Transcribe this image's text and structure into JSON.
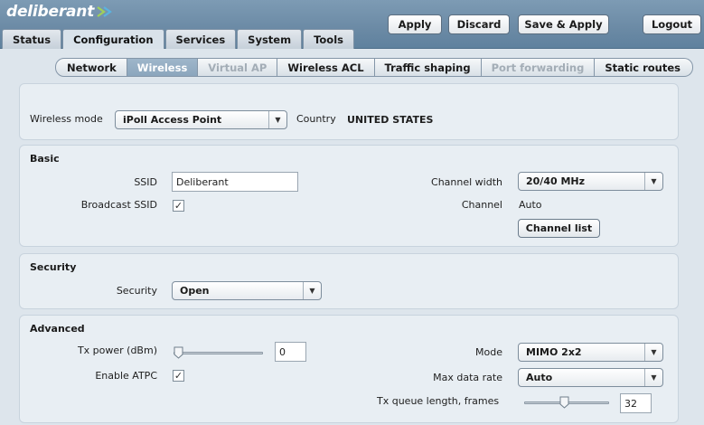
{
  "app": {
    "logo_text": "deliberant"
  },
  "toolbar": {
    "apply_label": "Apply",
    "discard_label": "Discard",
    "save_apply_label": "Save & Apply",
    "logout_label": "Logout"
  },
  "main_tabs": [
    {
      "label": "Status"
    },
    {
      "label": "Configuration",
      "active": true
    },
    {
      "label": "Services"
    },
    {
      "label": "System"
    },
    {
      "label": "Tools"
    }
  ],
  "sub_tabs": [
    {
      "label": "Network"
    },
    {
      "label": "Wireless",
      "active": true
    },
    {
      "label": "Virtual AP",
      "disabled": true
    },
    {
      "label": "Wireless ACL"
    },
    {
      "label": "Traffic shaping"
    },
    {
      "label": "Port forwarding",
      "disabled": true
    },
    {
      "label": "Static routes"
    }
  ],
  "general": {
    "wireless_mode_label": "Wireless mode",
    "wireless_mode_value": "iPoll Access Point",
    "country_label": "Country",
    "country_value": "UNITED STATES"
  },
  "basic": {
    "title": "Basic",
    "ssid_label": "SSID",
    "ssid_value": "Deliberant",
    "broadcast_ssid_label": "Broadcast SSID",
    "broadcast_ssid_checked": true,
    "channel_width_label": "Channel width",
    "channel_width_value": "20/40 MHz",
    "channel_label": "Channel",
    "channel_value": "Auto",
    "channel_list_label": "Channel list"
  },
  "security": {
    "title": "Security",
    "security_label": "Security",
    "security_value": "Open"
  },
  "advanced": {
    "title": "Advanced",
    "tx_power_label": "Tx power (dBm)",
    "tx_power_value": "0",
    "tx_power_slider_fraction": 0.0,
    "enable_atpc_label": "Enable ATPC",
    "enable_atpc_checked": true,
    "mode_label": "Mode",
    "mode_value": "MIMO 2x2",
    "max_data_rate_label": "Max data rate",
    "max_data_rate_value": "Auto",
    "tx_queue_label": "Tx queue length, frames",
    "tx_queue_value": "32",
    "tx_queue_slider_fraction": 0.47
  },
  "icons": {
    "dropdown_arrow": "triangle-down",
    "checkmark": "check",
    "slider_thumb": "pointer-down-thumb"
  },
  "colors": {
    "header_bg": "#6b8aa5",
    "active_subtab": "#8ba6bd",
    "panel_bg": "#e8eef3",
    "disabled_text": "#a3adb6"
  }
}
